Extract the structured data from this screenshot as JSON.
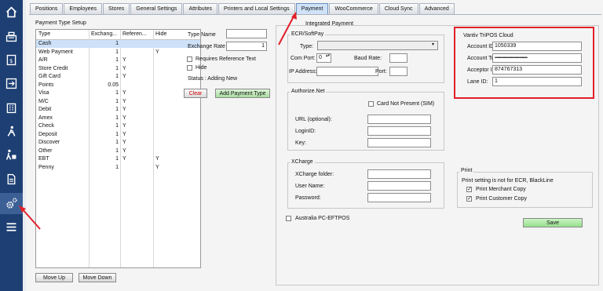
{
  "sidebar": [
    {
      "icon": "home-icon"
    },
    {
      "icon": "cash-register-icon"
    },
    {
      "icon": "invoice-icon"
    },
    {
      "icon": "logout-icon"
    },
    {
      "icon": "building-icon"
    },
    {
      "icon": "person-walking-icon"
    },
    {
      "icon": "delivery-icon"
    },
    {
      "icon": "document-icon"
    },
    {
      "icon": "gears-icon"
    },
    {
      "icon": "menu-icon"
    }
  ],
  "tabs": [
    "Positions",
    "Employees",
    "Stores",
    "General Settings",
    "Attributes",
    "Printers and Local Settings",
    "Payment",
    "WooCommerce",
    "Cloud Sync",
    "Advanced"
  ],
  "payment_setup": {
    "title": "Payment Type Setup",
    "columns": [
      "Type",
      "Exchang...",
      "Referen...",
      "Hide"
    ],
    "rows": [
      {
        "type": "Cash",
        "exchange": "1",
        "reference": "",
        "hide": ""
      },
      {
        "type": "Web Payment",
        "exchange": "1",
        "reference": "",
        "hide": "Y"
      },
      {
        "type": "A/R",
        "exchange": "1",
        "reference": "Y",
        "hide": ""
      },
      {
        "type": "Store Credit",
        "exchange": "1",
        "reference": "Y",
        "hide": ""
      },
      {
        "type": "Gift Card",
        "exchange": "1",
        "reference": "Y",
        "hide": ""
      },
      {
        "type": "Points",
        "exchange": "0.05",
        "reference": "",
        "hide": ""
      },
      {
        "type": "Visa",
        "exchange": "1",
        "reference": "Y",
        "hide": ""
      },
      {
        "type": "M/C",
        "exchange": "1",
        "reference": "Y",
        "hide": ""
      },
      {
        "type": "Debit",
        "exchange": "1",
        "reference": "Y",
        "hide": ""
      },
      {
        "type": "Amex",
        "exchange": "1",
        "reference": "Y",
        "hide": ""
      },
      {
        "type": "Check",
        "exchange": "1",
        "reference": "Y",
        "hide": ""
      },
      {
        "type": "Deposit",
        "exchange": "1",
        "reference": "Y",
        "hide": ""
      },
      {
        "type": "Discover",
        "exchange": "1",
        "reference": "Y",
        "hide": ""
      },
      {
        "type": "Other",
        "exchange": "1",
        "reference": "Y",
        "hide": ""
      },
      {
        "type": "EBT",
        "exchange": "1",
        "reference": "Y",
        "hide": "Y"
      },
      {
        "type": "Penny",
        "exchange": "1",
        "reference": "",
        "hide": "Y"
      }
    ],
    "move_up": "Move Up",
    "move_down": "Move Down"
  },
  "form": {
    "type_name_label": "Type Name",
    "type_name_value": "",
    "exchange_rate_label": "Exchange Rate",
    "exchange_rate_value": "1",
    "requires_reference_label": "Requires Reference Text",
    "hide_label": "Hide",
    "status_text": "Status : Adding New",
    "clear_label": "Clear",
    "add_label": "Add Payment Type"
  },
  "integrated": {
    "title": "Integrated Payment",
    "ecr": {
      "title": "ECR/SoftPay",
      "type_label": "Type:",
      "type_value": "",
      "com_port_label": "Com Port:",
      "com_port_value": "0",
      "baud_rate_label": "Baud Rate:",
      "baud_rate_value": "",
      "ip_label": "IP Address:",
      "ip_value": "",
      "port_label": "Port:",
      "port_value": ""
    },
    "vantiv": {
      "title": "Vantiv TriPOS Cloud",
      "account_id_label": "Account ID:",
      "account_id_value": "1050339",
      "account_token_label": "Account Token:",
      "account_token_value": "••••••••••••••••••••••••••••••••••••",
      "acceptor_id_label": "Acceptor ID:",
      "acceptor_id_value": "874767313",
      "lane_id_label": "Lane ID:",
      "lane_id_value": "1"
    },
    "authorize": {
      "title": "Authorize.Net",
      "card_not_present_label": "Card Not Present (SIM)",
      "url_label": "URL (optional):",
      "login_label": "LoginID:",
      "key_label": "Key:"
    },
    "xcharge": {
      "title": "XCharge",
      "folder_label": "XCharge folder:",
      "user_label": "User Name:",
      "password_label": "Password:"
    },
    "australia_label": "Australia PC-EFTPOS",
    "print": {
      "title": "Print",
      "note": "Print setting is not for ECR, BlackLine",
      "merchant_label": "Print Merchant Copy",
      "customer_label": "Print Customer Copy"
    },
    "save_label": "Save"
  },
  "colors": {
    "sidebar": "#1d3f73",
    "highlight": "#e2202a",
    "arrow": "#e2202a",
    "save_button": "#a6e8a0"
  }
}
